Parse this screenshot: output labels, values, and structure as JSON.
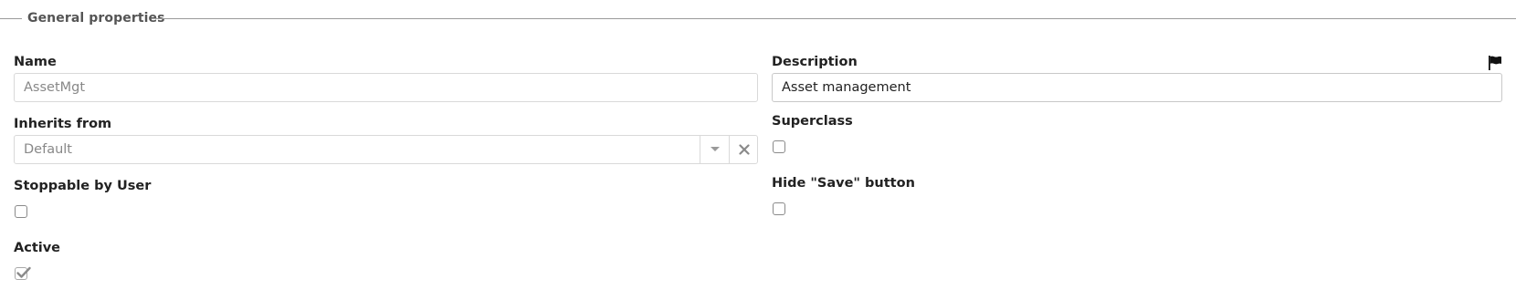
{
  "section": {
    "title": "General properties"
  },
  "fields": {
    "name": {
      "label": "Name",
      "value": "AssetMgt"
    },
    "description": {
      "label": "Description",
      "value": "Asset management"
    },
    "inherits_from": {
      "label": "Inherits from",
      "value": "Default"
    },
    "superclass": {
      "label": "Superclass",
      "checked": false
    },
    "stoppable_by_user": {
      "label": "Stoppable by User",
      "checked": false
    },
    "hide_save_button": {
      "label": "Hide \"Save\" button",
      "checked": false
    },
    "active": {
      "label": "Active",
      "checked": true
    }
  },
  "icons": {
    "translate": "flag-icon",
    "dropdown": "chevron-down-icon",
    "clear": "close-icon",
    "check": "check-icon"
  }
}
